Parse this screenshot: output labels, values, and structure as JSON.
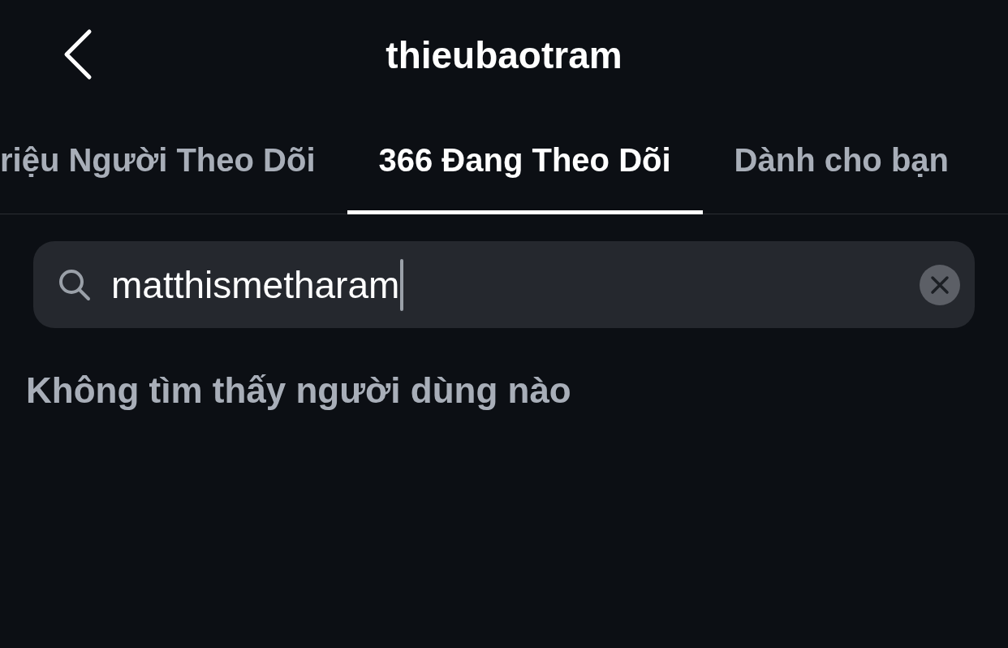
{
  "header": {
    "title": "thieubaotram"
  },
  "tabs": [
    {
      "label": "riệu Người Theo Dõi",
      "selected": false
    },
    {
      "label": "366 Đang Theo Dõi",
      "selected": true
    },
    {
      "label": "Dành cho bạn",
      "selected": false
    }
  ],
  "search": {
    "value": "matthismetharam"
  },
  "empty_message": "Không tìm thấy người dùng nào"
}
